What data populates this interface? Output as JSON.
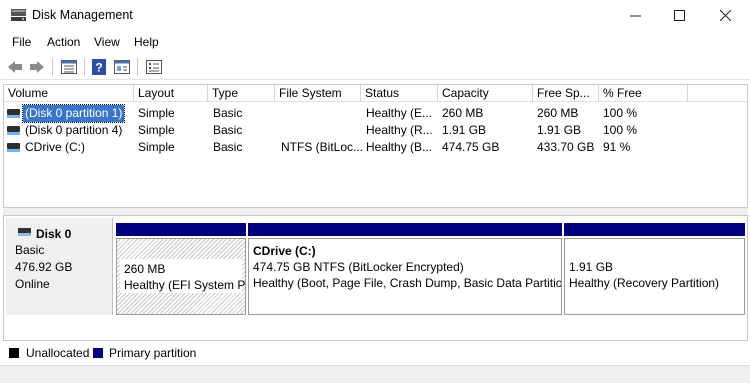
{
  "window": {
    "title": "Disk Management",
    "minimize_glyph": "—",
    "maximize_glyph": "☐",
    "close_glyph": "✕"
  },
  "menu": {
    "items": [
      "File",
      "Action",
      "View",
      "Help"
    ]
  },
  "toolbar": {
    "icons": [
      "back-arrow-icon",
      "forward-arrow-icon",
      "disk-list-icon",
      "help-icon",
      "console-icon",
      "properties-icon"
    ],
    "help_glyph": "?"
  },
  "volume_table": {
    "columns": [
      "Volume",
      "Layout",
      "Type",
      "File System",
      "Status",
      "Capacity",
      "Free Sp...",
      "% Free"
    ],
    "rows": [
      {
        "volume": "(Disk 0 partition 1)",
        "layout": "Simple",
        "type": "Basic",
        "fs": "",
        "status": "Healthy (E...",
        "capacity": "260 MB",
        "free": "260 MB",
        "pct": "100 %",
        "selected": true
      },
      {
        "volume": "(Disk 0 partition 4)",
        "layout": "Simple",
        "type": "Basic",
        "fs": "",
        "status": "Healthy (R...",
        "capacity": "1.91 GB",
        "free": "1.91 GB",
        "pct": "100 %",
        "selected": false
      },
      {
        "volume": "CDrive (C:)",
        "layout": "Simple",
        "type": "Basic",
        "fs": "NTFS (BitLoc...",
        "status": "Healthy (B...",
        "capacity": "474.75 GB",
        "free": "433.70 GB",
        "pct": "91 %",
        "selected": false
      }
    ]
  },
  "disk": {
    "name": "Disk 0",
    "type": "Basic",
    "size": "476.92 GB",
    "state": "Online",
    "partitions": [
      {
        "title": "",
        "line1": "260 MB",
        "line2": "Healthy (EFI System Pa"
      },
      {
        "title": "CDrive  (C:)",
        "line1": "474.75 GB NTFS (BitLocker Encrypted)",
        "line2": "Healthy (Boot, Page File, Crash Dump, Basic Data Partitio"
      },
      {
        "title": "",
        "line1": "1.91 GB",
        "line2": "Healthy (Recovery Partition)"
      }
    ]
  },
  "legend": {
    "unallocated": "Unallocated",
    "primary": "Primary partition",
    "unallocated_color": "#000000",
    "primary_color": "#00007f"
  },
  "colors": {
    "selection": "#3a75c9",
    "partition_header": "#00007f"
  }
}
